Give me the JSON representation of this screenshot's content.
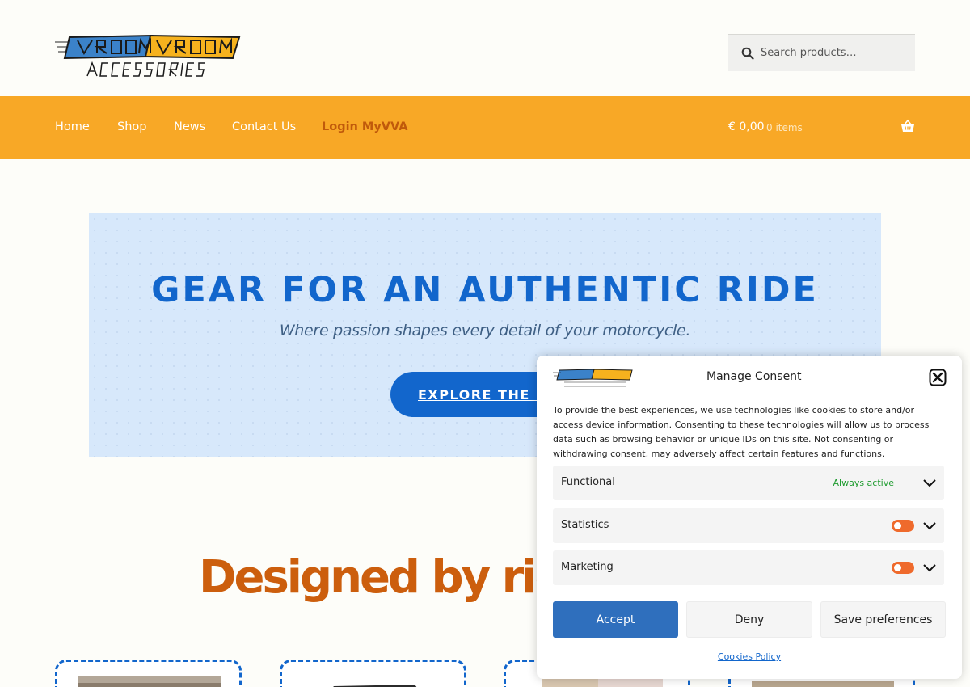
{
  "header": {
    "logo_alt": "VROOM VROOM ACCESSORIES",
    "search_placeholder": "Search products…"
  },
  "nav": {
    "items": [
      {
        "label": "Home"
      },
      {
        "label": "Shop"
      },
      {
        "label": "News"
      },
      {
        "label": "Contact Us"
      },
      {
        "label": "Login MyVVA"
      }
    ],
    "cart_total": "€ 0,00",
    "cart_count": "0 items"
  },
  "hero": {
    "title": "GEAR FOR AN AUTHENTIC RIDE",
    "subtitle": "Where passion shapes every detail of your motorcycle.",
    "button_label": "EXPLORE THE SHOP"
  },
  "section": {
    "heading": "Designed by riders"
  },
  "consent": {
    "title": "Manage Consent",
    "text": "To provide the best experiences, we use technologies like cookies to store and/or access device information. Consenting to these technologies will allow us to process data such as browsing behavior or unique IDs on this site. Not consenting or withdrawing consent, may adversely affect certain features and functions.",
    "categories": [
      {
        "label": "Functional",
        "status": "Always active"
      },
      {
        "label": "Statistics"
      },
      {
        "label": "Marketing"
      }
    ],
    "accept_label": "Accept",
    "deny_label": "Deny",
    "save_label": "Save preferences",
    "policy_link": "Cookies Policy"
  },
  "colors": {
    "nav_bg": "#f8a826",
    "accent_blue": "#1266cc",
    "accent_orange": "#cc5e0d",
    "toggle": "#ef6a2c"
  }
}
